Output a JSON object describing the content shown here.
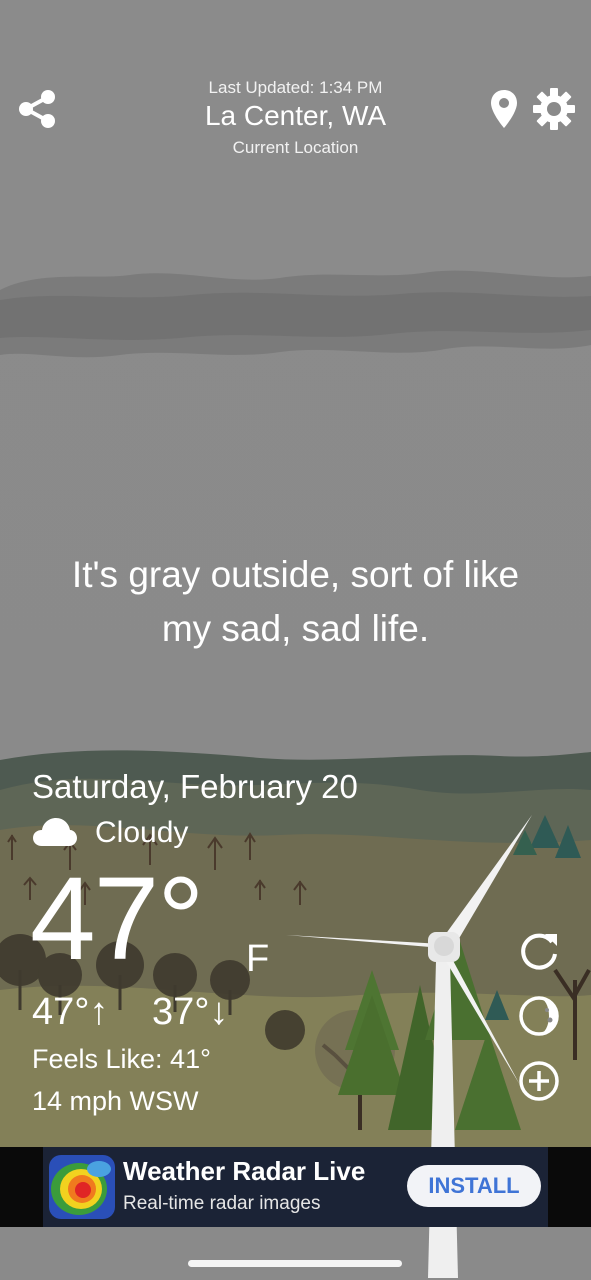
{
  "header": {
    "last_updated": "Last Updated: 1:34 PM",
    "location": "La Center, WA",
    "location_sub": "Current Location",
    "share_icon": "share-icon",
    "pin_icon": "location-pin-icon",
    "settings_icon": "gear-icon"
  },
  "quip": {
    "line1": "It's gray outside, sort of like",
    "line2": "my sad, sad life."
  },
  "weather": {
    "date": "Saturday, February 20",
    "condition": "Cloudy",
    "condition_icon": "cloud-icon",
    "temp": "47°",
    "unit": "F",
    "high": "47°↑",
    "low": "37°↓",
    "feels_like": "Feels Like: 41°",
    "wind": "14 mph WSW"
  },
  "side_buttons": {
    "refresh_icon": "refresh-icon",
    "moon_icon": "moon-phase-icon",
    "add_icon": "add-circle-icon"
  },
  "ad": {
    "title": "Weather Radar Live",
    "subtitle": "Real-time radar images",
    "cta": "INSTALL"
  },
  "colors": {
    "sky": "#8a8a8a",
    "hills_far": "#4f5a52",
    "ground": "#7a7458",
    "tree_green": "#4d6f2e",
    "ad_background": "#1b2336",
    "install_text": "#3f74d6"
  }
}
